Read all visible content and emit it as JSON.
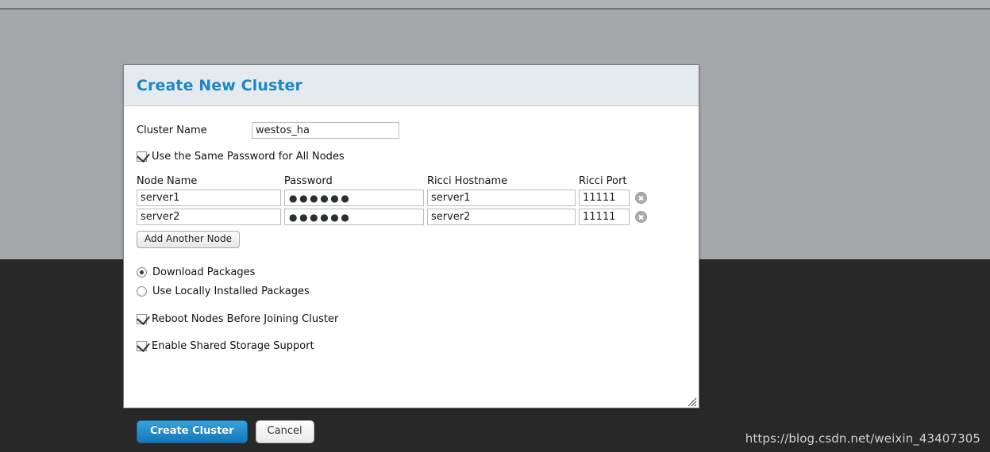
{
  "watermark": "https://blog.csdn.net/weixin_43407305",
  "colors": {
    "accent": "#1b87c6",
    "header_bg": "#e4eaee",
    "page_overlay": "#a5a7aa",
    "page_dark": "#282829",
    "top_band": "#b0b1b3",
    "primary_button": "#1476b8"
  },
  "dialog": {
    "title": "Create New Cluster",
    "cluster_name": {
      "label": "Cluster Name",
      "value": "westos_ha"
    },
    "same_password": {
      "label": "Use the Same Password for All Nodes",
      "checked": true
    },
    "nodes_table": {
      "headers": {
        "node_name": "Node Name",
        "password": "Password",
        "ricci_hostname": "Ricci Hostname",
        "ricci_port": "Ricci Port"
      },
      "rows": [
        {
          "node_name": "server1",
          "password_mask": "●●●●●●",
          "ricci_hostname": "server1",
          "ricci_port": "11111",
          "remove_icon": "circle-x-icon"
        },
        {
          "node_name": "server2",
          "password_mask": "●●●●●●",
          "ricci_hostname": "server2",
          "ricci_port": "11111",
          "remove_icon": "circle-x-icon"
        }
      ],
      "add_node_label": "Add Another Node"
    },
    "package_source": {
      "options": [
        {
          "label": "Download Packages",
          "selected": true
        },
        {
          "label": "Use Locally Installed Packages",
          "selected": false
        }
      ]
    },
    "reboot_nodes": {
      "label": "Reboot Nodes Before Joining Cluster",
      "checked": true
    },
    "shared_storage": {
      "label": "Enable Shared Storage Support",
      "checked": true
    },
    "footer": {
      "create_label": "Create Cluster",
      "cancel_label": "Cancel"
    },
    "resize_grip": "resize-handle-icon"
  }
}
